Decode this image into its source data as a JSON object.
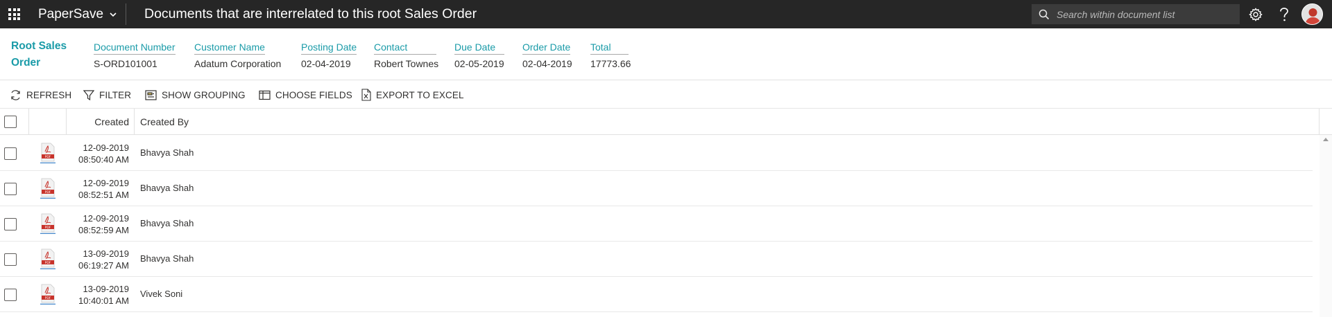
{
  "topbar": {
    "app_name": "PaperSave",
    "page_title": "Documents that are interrelated to this root Sales Order",
    "search_placeholder": "Search within document list"
  },
  "record": {
    "title": "Root Sales Order",
    "fields": [
      {
        "label": "Document Number",
        "value": "S-ORD101001"
      },
      {
        "label": "Customer Name",
        "value": "Adatum Corporation"
      },
      {
        "label": "Posting Date",
        "value": "02-04-2019"
      },
      {
        "label": "Contact",
        "value": "Robert Townes"
      },
      {
        "label": "Due Date",
        "value": "02-05-2019"
      },
      {
        "label": "Order Date",
        "value": "02-04-2019"
      },
      {
        "label": "Total",
        "value": "17773.66"
      }
    ]
  },
  "commands": {
    "refresh": "REFRESH",
    "filter": "FILTER",
    "show_grouping": "SHOW GROUPING",
    "choose_fields": "CHOOSE FIELDS",
    "export_excel": "EXPORT TO EXCEL"
  },
  "grid": {
    "columns": {
      "created": "Created",
      "created_by": "Created By"
    },
    "rows": [
      {
        "date": "12-09-2019",
        "time": "08:50:40 AM",
        "by": "Bhavya Shah"
      },
      {
        "date": "12-09-2019",
        "time": "08:52:51 AM",
        "by": "Bhavya Shah"
      },
      {
        "date": "12-09-2019",
        "time": "08:52:59 AM",
        "by": "Bhavya Shah"
      },
      {
        "date": "13-09-2019",
        "time": "06:19:27 AM",
        "by": "Bhavya Shah"
      },
      {
        "date": "13-09-2019",
        "time": "10:40:01 AM",
        "by": "Vivek Soni"
      }
    ]
  },
  "colors": {
    "accent": "#1a9ba8",
    "topbar": "#262626",
    "pdf_red": "#c8332b"
  },
  "icons": [
    "waffle-icon",
    "chevron-down-icon",
    "search-icon",
    "gear-icon",
    "help-icon",
    "refresh-icon",
    "filter-icon",
    "grouping-icon",
    "choose-fields-icon",
    "excel-icon",
    "pdf-icon"
  ]
}
